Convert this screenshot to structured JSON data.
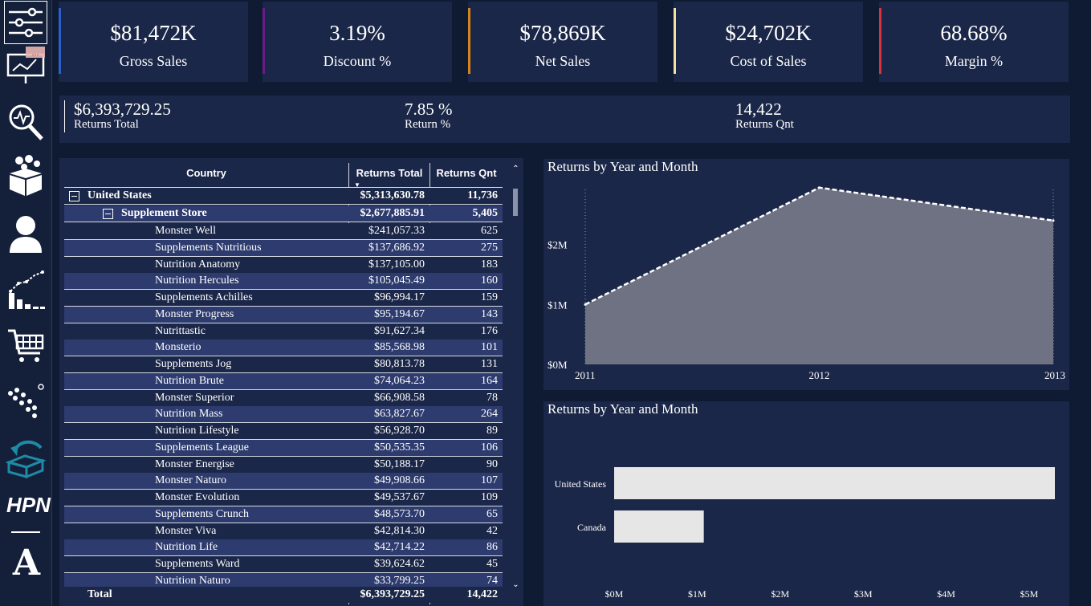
{
  "sidebar": {
    "items": [
      {
        "name": "filters-icon"
      },
      {
        "name": "presentation-chart-icon"
      },
      {
        "name": "analysis-magnifier-icon"
      },
      {
        "name": "product-box-icon"
      },
      {
        "name": "customer-icon"
      },
      {
        "name": "trend-chart-icon"
      },
      {
        "name": "shopping-cart-icon"
      },
      {
        "name": "scatter-dots-icon"
      },
      {
        "name": "returns-box-icon"
      }
    ],
    "brand": "HPN",
    "logo_letter": "A",
    "accent": "#ffffff"
  },
  "kpis": [
    {
      "value": "$81,472K",
      "label": "Gross Sales",
      "color": "#2d5fc9"
    },
    {
      "value": "3.19%",
      "label": "Discount %",
      "color": "#6a1b8a"
    },
    {
      "value": "$78,869K",
      "label": "Net Sales",
      "color": "#d4861a"
    },
    {
      "value": "$24,702K",
      "label": "Cost of Sales",
      "color": "#f2e1a0"
    },
    {
      "value": "68.68%",
      "label": "Margin %",
      "color": "#d8323f"
    }
  ],
  "returns": {
    "total": {
      "value": "$6,393,729.25",
      "label": "Returns Total"
    },
    "pct": {
      "value": "7.85 %",
      "label": "Return %"
    },
    "qnt": {
      "value": "14,422",
      "label": "Returns Qnt"
    }
  },
  "table": {
    "headers": {
      "country": "Country",
      "total": "Returns Total",
      "qnt": "Returns Qnt"
    },
    "country_row": {
      "name": "United States",
      "total": "$5,313,630.78",
      "qnt": "11,736"
    },
    "group_row": {
      "name": "Supplement Store",
      "total": "$2,677,885.91",
      "qnt": "5,405"
    },
    "rows": [
      {
        "name": "Monster Well",
        "total": "$241,057.33",
        "qnt": "625"
      },
      {
        "name": "Supplements Nutritious",
        "total": "$137,686.92",
        "qnt": "275"
      },
      {
        "name": "Nutrition Anatomy",
        "total": "$137,105.00",
        "qnt": "183"
      },
      {
        "name": "Nutrition Hercules",
        "total": "$105,045.49",
        "qnt": "160"
      },
      {
        "name": "Supplements Achilles",
        "total": "$96,994.17",
        "qnt": "159"
      },
      {
        "name": "Monster Progress",
        "total": "$95,194.67",
        "qnt": "143"
      },
      {
        "name": "Nutrittastic",
        "total": "$91,627.34",
        "qnt": "176"
      },
      {
        "name": "Monsterio",
        "total": "$85,568.98",
        "qnt": "101"
      },
      {
        "name": "Supplements Jog",
        "total": "$80,813.78",
        "qnt": "131"
      },
      {
        "name": "Nutrition Brute",
        "total": "$74,064.23",
        "qnt": "164"
      },
      {
        "name": "Monster Superior",
        "total": "$66,908.58",
        "qnt": "78"
      },
      {
        "name": "Nutrition Mass",
        "total": "$63,827.67",
        "qnt": "264"
      },
      {
        "name": "Nutrition Lifestyle",
        "total": "$56,928.70",
        "qnt": "89"
      },
      {
        "name": "Supplements League",
        "total": "$50,535.35",
        "qnt": "106"
      },
      {
        "name": "Monster Energise",
        "total": "$50,188.17",
        "qnt": "90"
      },
      {
        "name": "Monster Naturo",
        "total": "$49,908.66",
        "qnt": "107"
      },
      {
        "name": "Monster Evolution",
        "total": "$49,537.67",
        "qnt": "109"
      },
      {
        "name": "Supplements Crunch",
        "total": "$48,573.70",
        "qnt": "65"
      },
      {
        "name": "Monster Viva",
        "total": "$42,814.30",
        "qnt": "42"
      },
      {
        "name": "Nutrition Life",
        "total": "$42,714.22",
        "qnt": "86"
      },
      {
        "name": "Supplements Ward",
        "total": "$39,624.62",
        "qnt": "45"
      },
      {
        "name": "Nutrition Naturo",
        "total": "$33,799.25",
        "qnt": "74"
      }
    ],
    "total_row": {
      "name": "Total",
      "total": "$6,393,729.25",
      "qnt": "14,422"
    }
  },
  "chart_data": [
    {
      "type": "area",
      "title": "Returns by Year and Month",
      "x": [
        "2011",
        "2012",
        "2013"
      ],
      "series": [
        {
          "values": [
            1.0,
            2.95,
            2.4
          ]
        }
      ],
      "ylim": [
        0,
        3
      ],
      "yticks": [
        "$0M",
        "$1M",
        "$2M"
      ],
      "grid": true,
      "color": "#6e7283"
    },
    {
      "type": "bar",
      "title": "Returns by Year and Month",
      "categories": [
        "United States",
        "Canada"
      ],
      "values": [
        5.31,
        1.08
      ],
      "xlim": [
        0,
        5.5
      ],
      "xticks": [
        "$0M",
        "$1M",
        "$2M",
        "$3M",
        "$4M",
        "$5M"
      ],
      "color": "#e6e6e6"
    }
  ]
}
